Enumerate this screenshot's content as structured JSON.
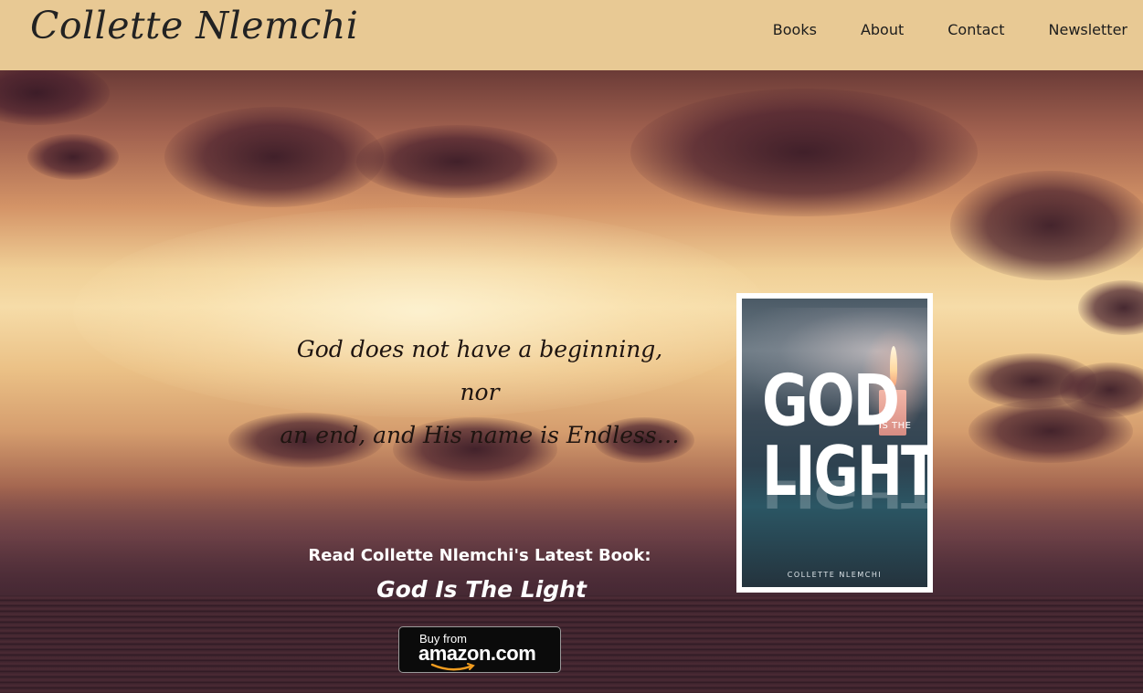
{
  "header": {
    "logo_text": "Collette Nlemchi",
    "nav": [
      {
        "label": "Books"
      },
      {
        "label": "About"
      },
      {
        "label": "Contact"
      },
      {
        "label": "Newsletter"
      }
    ]
  },
  "hero": {
    "quote_line1": "God does not have a beginning, nor",
    "quote_line2": "an end, and His name is Endless…",
    "latest_label": "Read Collette Nlemchi's Latest Book:",
    "latest_title": "God Is The Light",
    "amazon_button": {
      "small_text": "Buy from",
      "big_text": "amazon.com"
    }
  },
  "book_cover": {
    "title_top": "GOD",
    "title_middle": "IS THE",
    "title_bottom": "LIGHT",
    "author": "COLLETTE NLEMCHI"
  },
  "colors": {
    "header_bg": "#e8c994",
    "nav_text": "#1c1c1c",
    "hero_text": "#ffffff",
    "quote_text": "#1e1410"
  }
}
